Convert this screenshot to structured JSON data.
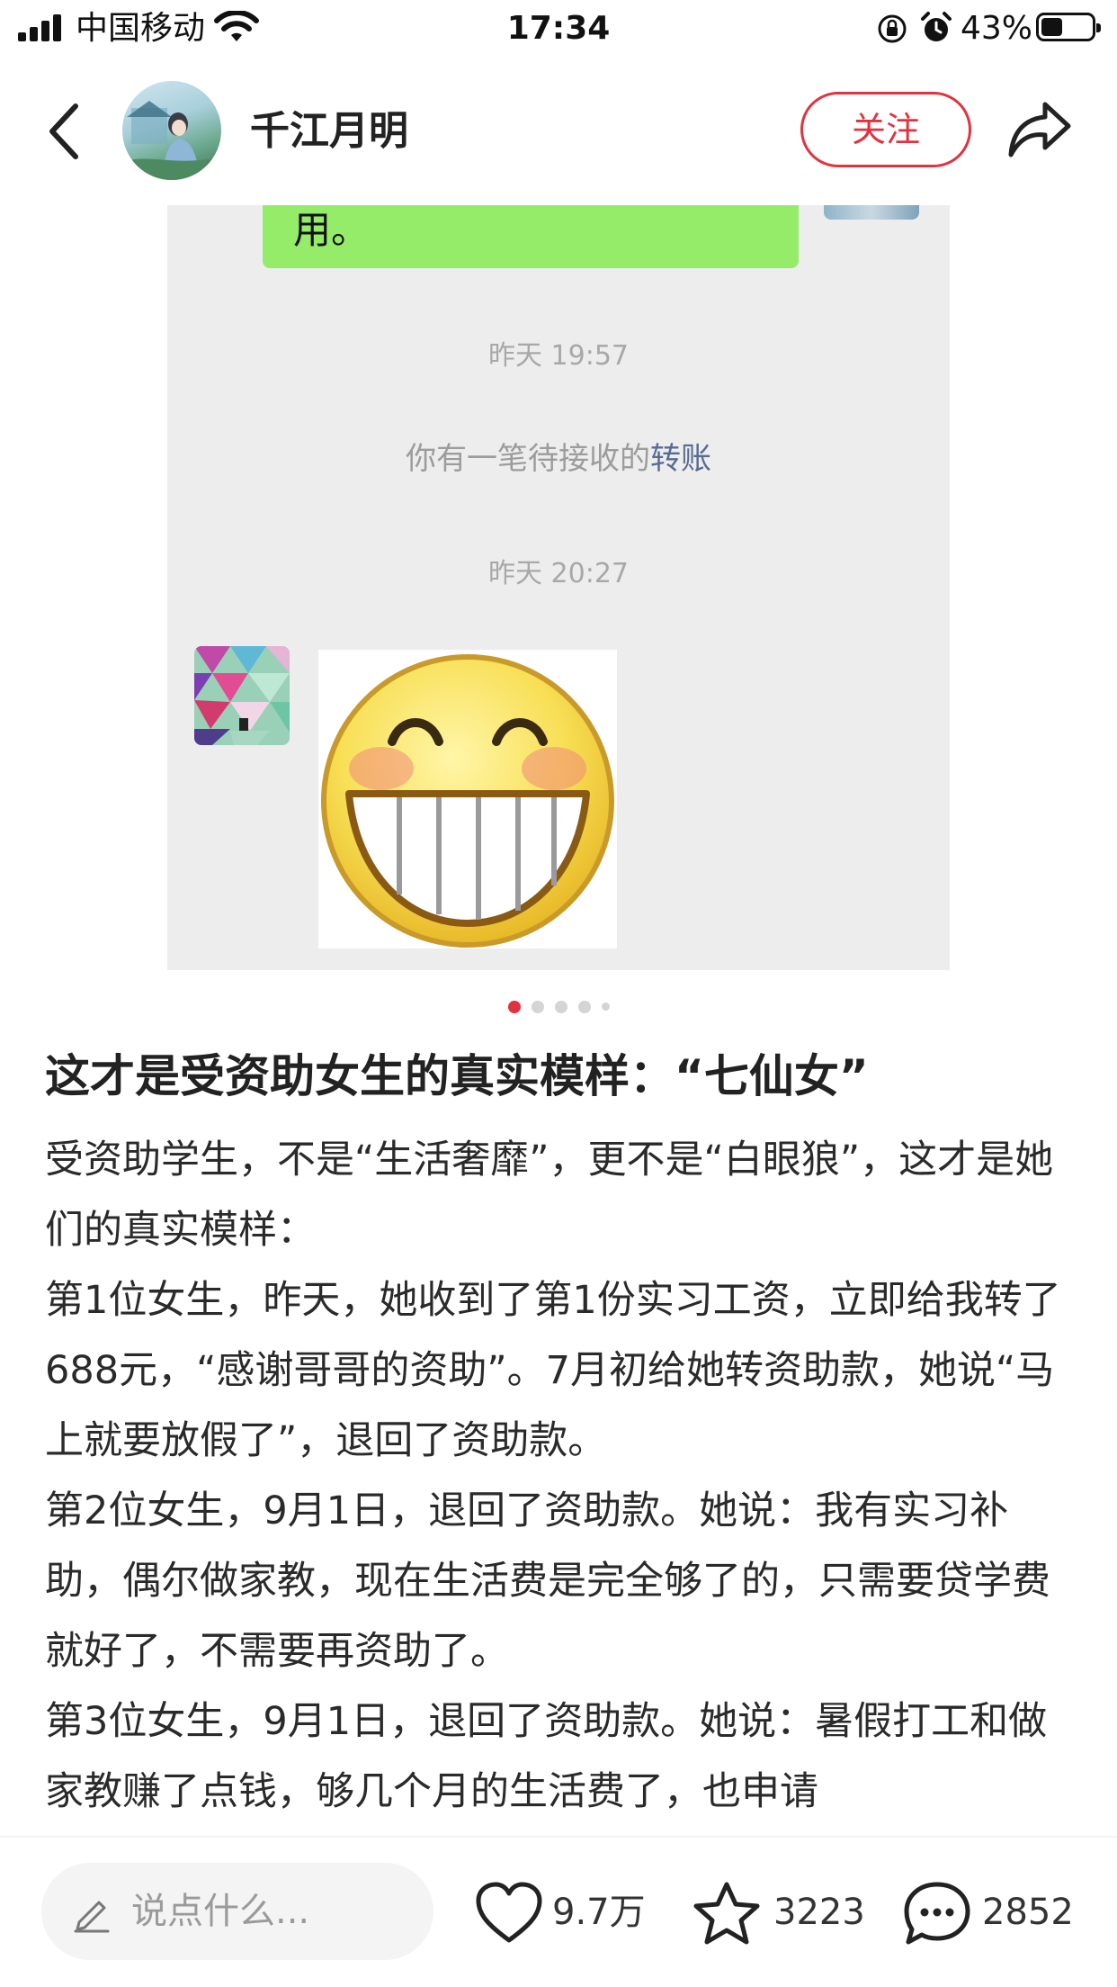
{
  "status_bar": {
    "carrier": "中国移动",
    "time": "17:34",
    "battery_percent": "43%",
    "battery_level": 0.43,
    "icons": [
      "signal-icon",
      "wifi-icon",
      "orientation-lock-icon",
      "alarm-icon",
      "battery-icon"
    ]
  },
  "nav": {
    "back_icon": "chevron-left-icon",
    "author_name": "千江月明",
    "follow_label": "关注",
    "share_icon": "share-icon"
  },
  "chat_image": {
    "bubble_text": "用。",
    "time1": "昨天 19:57",
    "notice_prefix": "你有一笔待接收的",
    "notice_link": "转账",
    "time2": "昨天 20:27",
    "sticker": "grinning-face-sticker"
  },
  "carousel": {
    "total_pages": 5,
    "current_page": 1
  },
  "post": {
    "title": "这才是受资助女生的真实模样：“七仙女”",
    "paragraphs": [
      "受资助学生，不是“生活奢靡”，更不是“白眼狼”，这才是她们的真实模样：",
      "第1位女生，昨天，她收到了第1份实习工资，立即给我转了688元，“感谢哥哥的资助”。7月初给她转资助款，她说“马上就要放假了”，退回了资助款。",
      "第2位女生，9月1日，退回了资助款。她说：我有实习补助，偶尔做家教，现在生活费是完全够了的，只需要贷学费就好了，不需要再资助了。",
      "第3位女生，9月1日，退回了资助款。她说：暑假打工和做家教赚了点钱，够几个月的生活费了，也申请"
    ]
  },
  "bottom_bar": {
    "comment_placeholder": "说点什么...",
    "likes": "9.7万",
    "favorites": "3223",
    "comments": "2852"
  },
  "colors": {
    "accent_red": "#e3323f",
    "wechat_green": "#95ec69",
    "link_blue": "#576b95"
  }
}
